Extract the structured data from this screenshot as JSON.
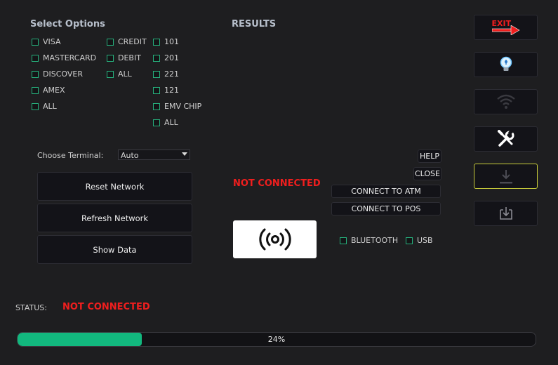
{
  "options": {
    "title": "Select Options",
    "card_types": [
      "VISA",
      "MASTERCARD",
      "DISCOVER",
      "AMEX",
      "ALL"
    ],
    "payment_types": [
      "CREDIT",
      "DEBIT",
      "ALL"
    ],
    "codes": [
      "101",
      "201",
      "221",
      "121",
      "EMV CHIP",
      "ALL"
    ]
  },
  "results": {
    "title": "RESULTS",
    "connection_status": "NOT CONNECTED"
  },
  "terminal": {
    "label": "Choose Terminal:",
    "selected": "Auto"
  },
  "actions": {
    "reset": "Reset Network",
    "refresh": "Refresh Network",
    "show": "Show Data"
  },
  "buttons": {
    "help": "HELP",
    "close": "CLOSE",
    "connect_atm": "CONNECT TO ATM",
    "connect_pos": "CONNECT TO POS"
  },
  "interfaces": [
    "BLUETOOTH",
    "USB"
  ],
  "sidebar": {
    "exit_label": "EXIT"
  },
  "status": {
    "label": "STATUS:",
    "value": "NOT CONNECTED"
  },
  "progress": {
    "percent": 24,
    "label": "24%"
  },
  "colors": {
    "accent": "#12b87e",
    "error": "#f01e1e",
    "highlight": "#c8cc3a"
  }
}
